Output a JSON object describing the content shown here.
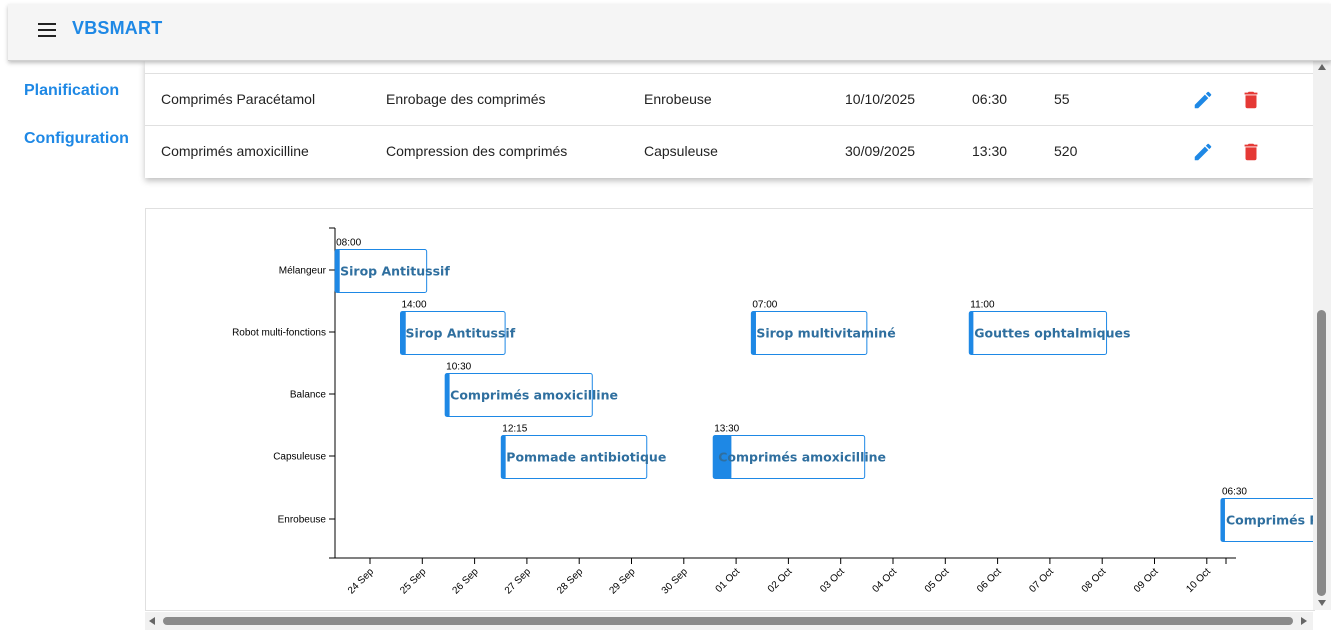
{
  "app": {
    "title": "VBSMART"
  },
  "icons": {
    "menu": "menu-icon",
    "edit": "edit-icon",
    "delete": "delete-icon"
  },
  "colors": {
    "accent": "#1e88e5",
    "danger": "#e53935",
    "bar_fill": "#ffffff",
    "bar_border": "#1e88e5",
    "bar_text": "#2f6f9f"
  },
  "nav": {
    "items": [
      {
        "label": "Planification"
      },
      {
        "label": "Configuration"
      }
    ]
  },
  "table": {
    "rows": [
      {
        "product": "Comprimés Paracétamol",
        "step": "Enrobage des comprimés",
        "machine": "Enrobeuse",
        "date": "10/10/2025",
        "time": "06:30",
        "qty": "55"
      },
      {
        "product": "Comprimés amoxicilline",
        "step": "Compression des comprimés",
        "machine": "Capsuleuse",
        "date": "30/09/2025",
        "time": "13:30",
        "qty": "520"
      }
    ]
  },
  "chart_data": {
    "type": "gantt",
    "x_ticks": [
      "24 Sep",
      "25 Sep",
      "26 Sep",
      "27 Sep",
      "28 Sep",
      "29 Sep",
      "30 Sep",
      "01 Oct",
      "02 Oct",
      "03 Oct",
      "04 Oct",
      "05 Oct",
      "06 Oct",
      "07 Oct",
      "08 Oct",
      "09 Oct",
      "10 Oct"
    ],
    "categories": [
      "Mélangeur",
      "Robot multi-fonctions",
      "Balance",
      "Capsuleuse",
      "Enrobeuse"
    ],
    "tasks": [
      {
        "machine": "Mélangeur",
        "label": "Sirop Antitussif",
        "time": "08:00",
        "start": "2025-09-23T08:00",
        "end": "2025-09-25T02:00",
        "progress": 0.05
      },
      {
        "machine": "Robot multi-fonctions",
        "label": "Sirop Antitussif",
        "time": "14:00",
        "start": "2025-09-24T14:00",
        "end": "2025-09-26T14:00",
        "progress": 0.05
      },
      {
        "machine": "Robot multi-fonctions",
        "label": "Sirop multivitaminé",
        "time": "07:00",
        "start": "2025-10-01T07:00",
        "end": "2025-10-03T12:00",
        "progress": 0.04
      },
      {
        "machine": "Robot multi-fonctions",
        "label": "Gouttes ophtalmiques",
        "time": "11:00",
        "start": "2025-10-05T11:00",
        "end": "2025-10-08T02:00",
        "progress": 0.03
      },
      {
        "machine": "Balance",
        "label": "Comprimés amoxicilline",
        "time": "10:30",
        "start": "2025-09-25T10:30",
        "end": "2025-09-28T06:00",
        "progress": 0.03
      },
      {
        "machine": "Capsuleuse",
        "label": "Pommade antibiotique",
        "time": "12:15",
        "start": "2025-09-26T12:15",
        "end": "2025-09-29T07:00",
        "progress": 0.03
      },
      {
        "machine": "Capsuleuse",
        "label": "Comprimés amoxicilline",
        "time": "13:30",
        "start": "2025-09-30T13:30",
        "end": "2025-10-03T11:00",
        "progress": 0.12
      },
      {
        "machine": "Enrobeuse",
        "label": "Comprimés Paracétamol",
        "time": "06:30",
        "start": "2025-10-10T06:30",
        "end": "2025-10-12T12:00",
        "progress": 0.03
      }
    ]
  }
}
